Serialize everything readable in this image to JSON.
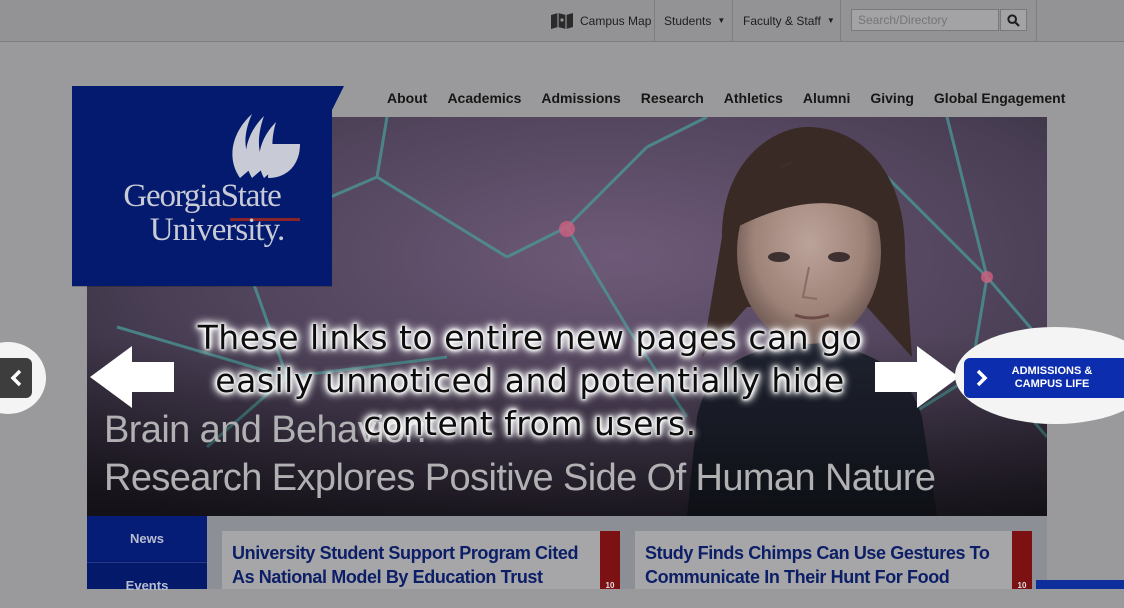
{
  "utility_bar": {
    "campus_map": "Campus Map",
    "students": "Students",
    "faculty_staff": "Faculty & Staff",
    "search_placeholder": "Search/Directory"
  },
  "main_nav": [
    "About",
    "Academics",
    "Admissions",
    "Research",
    "Athletics",
    "Alumni",
    "Giving",
    "Global Engagement"
  ],
  "logo": {
    "line1": "GeorgiaState",
    "line2": "University."
  },
  "hero": {
    "title_line1": "Brain and Behavior:",
    "title_line2": "Research Explores Positive Side Of Human Nature"
  },
  "annotation": "These links to entire new pages can go easily unnoticed and potentially hide content from users.",
  "carousel": {
    "next_label": "ADMISSIONS & CAMPUS LIFE"
  },
  "tabs": [
    "News",
    "Events"
  ],
  "news_cards": [
    {
      "title": "University Student Support Program Cited As National Model By Education Trust",
      "date_badge": "10"
    },
    {
      "title": "Study Finds Chimps Can Use Gestures To Communicate In Their Hunt For Food",
      "date_badge": "10"
    }
  ],
  "colors": {
    "brand_blue": "#031a6e",
    "button_blue": "#0d2daf",
    "date_red": "#7c1114",
    "overlay_gray": "#9a9a9c"
  }
}
